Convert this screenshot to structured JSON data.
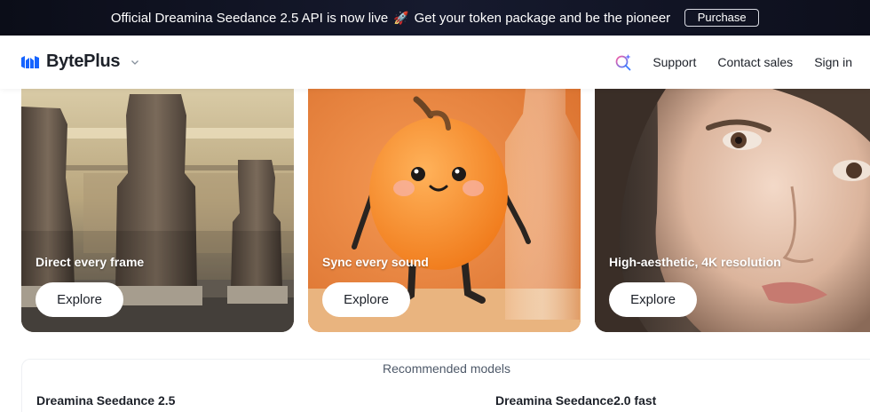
{
  "announcement": {
    "text": "Official Dreamina Seedance 2.5 API is now live",
    "rocket": "🚀",
    "text_2": "Get your token package and be the pioneer",
    "button_label": "Purchase"
  },
  "header": {
    "brand": "BytePlus",
    "nav": {
      "support": "Support",
      "contact_sales": "Contact sales",
      "sign_in": "Sign in"
    }
  },
  "cards": [
    {
      "title": "Direct every frame",
      "button": "Explore"
    },
    {
      "title": "Sync every sound",
      "button": "Explore"
    },
    {
      "title": "High-aesthetic, 4K resolution",
      "button": "Explore"
    }
  ],
  "recommended": {
    "heading": "Recommended models",
    "models": [
      "Dreamina Seedance 2.5",
      "Dreamina Seedance2.0 fast"
    ]
  },
  "colors": {
    "announcement_bg": "#0b0d18",
    "brand_blue": "#1664ff",
    "text_primary": "#1d2129",
    "text_secondary": "#4e5969"
  },
  "icons": {
    "logo": "byteplus-logo-icon",
    "brand_dropdown": "chevron-down-icon",
    "search": "ai-search-icon"
  }
}
